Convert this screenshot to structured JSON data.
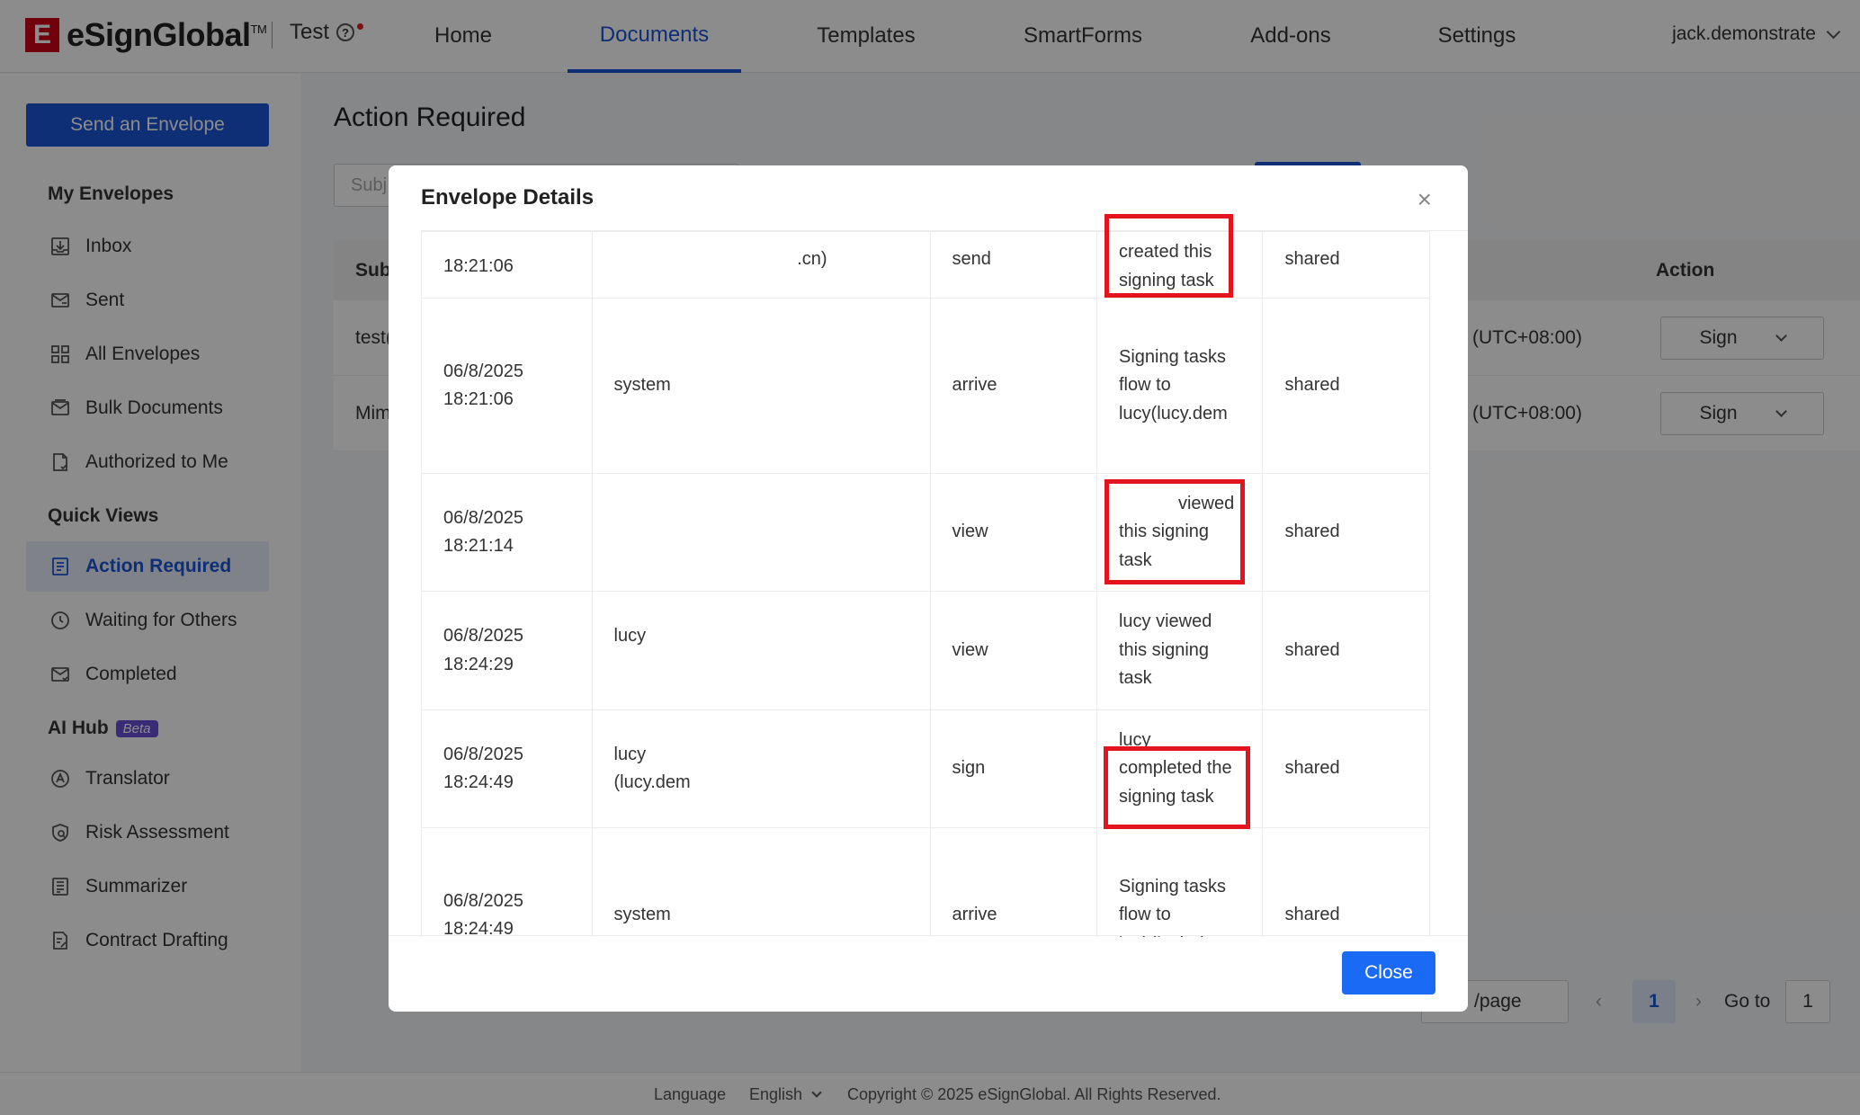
{
  "header": {
    "brand": "eSignGlobal",
    "brand_mark": "E",
    "tm": "TM",
    "workspace": "Test",
    "help_icon_glyph": "?",
    "nav": [
      {
        "label": "Home",
        "active": false
      },
      {
        "label": "Documents",
        "active": true
      },
      {
        "label": "Templates",
        "active": false
      },
      {
        "label": "SmartForms",
        "active": false
      },
      {
        "label": "Add-ons",
        "active": false
      },
      {
        "label": "Settings",
        "active": false
      }
    ],
    "user": "jack.demonstrate"
  },
  "sidebar": {
    "send_button": "Send an Envelope",
    "my_envelopes_title": "My Envelopes",
    "my_envelopes": [
      {
        "label": "Inbox",
        "icon": "inbox-icon"
      },
      {
        "label": "Sent",
        "icon": "sent-icon"
      },
      {
        "label": "All Envelopes",
        "icon": "grid-icon"
      },
      {
        "label": "Bulk Documents",
        "icon": "bulk-mail-icon"
      },
      {
        "label": "Authorized to Me",
        "icon": "authorized-doc-icon"
      }
    ],
    "quick_views_title": "Quick Views",
    "quick_views": [
      {
        "label": "Action Required",
        "icon": "action-list-icon",
        "active": true
      },
      {
        "label": "Waiting for Others",
        "icon": "clock-icon"
      },
      {
        "label": "Completed",
        "icon": "completed-mail-icon"
      }
    ],
    "ai_hub_title": "AI Hub",
    "ai_hub_badge": "Beta",
    "ai_hub": [
      {
        "label": "Translator",
        "icon": "translator-icon"
      },
      {
        "label": "Risk Assessment",
        "icon": "shield-icon"
      },
      {
        "label": "Summarizer",
        "icon": "summarizer-icon"
      },
      {
        "label": "Contract Drafting",
        "icon": "draft-icon"
      }
    ]
  },
  "main": {
    "title": "Action Required",
    "search_placeholder": "Subj",
    "table_headers": {
      "subject": "Sub",
      "action": "Action"
    },
    "rows": [
      {
        "subject": "test(",
        "timezone": "(UTC+08:00)",
        "action": "Sign"
      },
      {
        "subject": "Mim",
        "timezone": "(UTC+08:00)",
        "action": "Sign"
      }
    ],
    "pagination": {
      "page_size": "/page",
      "prev": "‹",
      "current_page": "1",
      "next": "›",
      "goto_label": "Go to",
      "goto_value": "1"
    }
  },
  "footer": {
    "language_label": "Language",
    "language_value": "English",
    "copyright": "Copyright © 2025 eSignGlobal. All Rights Reserved."
  },
  "modal": {
    "title": "Envelope Details",
    "close_x": "×",
    "close_button": "Close",
    "log_rows": [
      {
        "time": "18:21:06",
        "operator": ".cn)",
        "action": "send",
        "description": "created this\nsigning task",
        "permission": "shared"
      },
      {
        "time": "06/8/2025\n18:21:06",
        "operator": "system",
        "action": "arrive",
        "description": "Signing tasks\nflow to\nlucy(lucy.dem",
        "permission": "shared"
      },
      {
        "time": "06/8/2025\n18:21:14",
        "operator": "",
        "action": "view",
        "description": "viewed\nthis signing\ntask",
        "permission": "shared"
      },
      {
        "time": "06/8/2025\n18:24:29",
        "operator": "lucy",
        "action": "view",
        "description": "lucy viewed\nthis signing\ntask",
        "permission": "shared"
      },
      {
        "time": "06/8/2025\n18:24:49",
        "operator": "lucy\n(lucy.dem",
        "action": "sign",
        "description": "lucy\ncompleted the\nsigning task",
        "permission": "shared"
      },
      {
        "time": "06/8/2025\n18:24:49",
        "operator": "system",
        "action": "arrive",
        "description": "Signing tasks\nflow to\njack(jack.dem",
        "permission": "shared"
      }
    ]
  },
  "colors": {
    "brand_blue": "#1b54d6",
    "close_button_blue": "#1b6af5",
    "highlight_red": "#e3141e",
    "beta_purple": "#6b4fd8",
    "logo_red": "#d0021b"
  }
}
